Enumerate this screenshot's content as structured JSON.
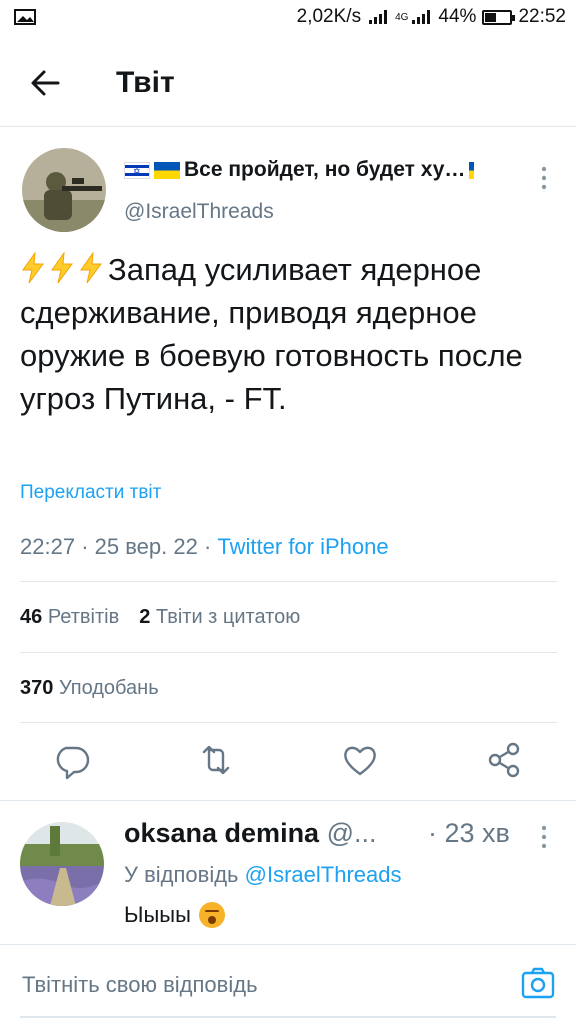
{
  "status_bar": {
    "speed": "2,02K/s",
    "network": "4G",
    "battery": "44%",
    "battery_level": 0.44,
    "time": "22:52"
  },
  "header": {
    "title": "Твіт"
  },
  "tweet": {
    "display_name": "Все пройдет, но будет ху…",
    "handle": "@IsraelThreads",
    "text": "Запад усиливает ядерное сдерживание, приводя ядерное оружие в боевую готовность после угроз Путина, - FT.",
    "prefix_icons": [
      "lightning-emoji",
      "lightning-emoji",
      "lightning-emoji"
    ],
    "translate": "Перекласти твіт",
    "time": "22:27",
    "date": "25 вер. 22",
    "source": "Twitter for iPhone",
    "retweets_count": "46",
    "retweets_label": "Ретвітів",
    "quotes_count": "2",
    "quotes_label": "Твіти з цитатою",
    "likes_count": "370",
    "likes_label": "Уподобань"
  },
  "reply": {
    "name": "oksana demina",
    "handle": "@...",
    "time": "· 23 хв",
    "reply_to_prefix": "У відповідь",
    "reply_to_handle": "@IsraelThreads",
    "text": "Ыыыы"
  },
  "compose": {
    "placeholder": "Твітніть свою відповідь"
  },
  "colors": {
    "accent": "#1da1f2",
    "muted": "#657786",
    "text": "#14171a",
    "divider": "#e1e8ed"
  }
}
